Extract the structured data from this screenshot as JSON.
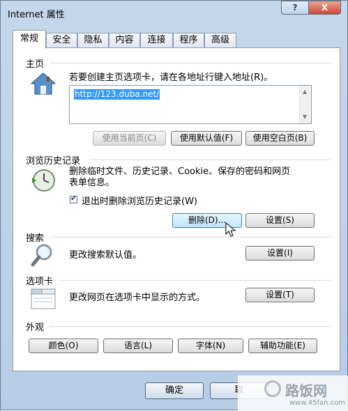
{
  "window": {
    "title": "Internet 属性",
    "help_label": "?",
    "close_label": "X"
  },
  "tabs": [
    {
      "label": "常规",
      "active": true
    },
    {
      "label": "安全"
    },
    {
      "label": "隐私"
    },
    {
      "label": "内容"
    },
    {
      "label": "连接"
    },
    {
      "label": "程序"
    },
    {
      "label": "高级"
    }
  ],
  "home": {
    "title": "主页",
    "desc": "若要创建主页选项卡，请在各地址行键入地址(R)。",
    "url": "http://123.duba.net/",
    "btn_current": "使用当前页(C)",
    "btn_default": "使用默认值(F)",
    "btn_blank": "使用空白页(B)",
    "icon": "house-icon"
  },
  "history": {
    "title": "浏览历史记录",
    "desc_line1": "删除临时文件、历史记录、Cookie、保存的密码和网页",
    "desc_line2": "表单信息。",
    "checkbox_label": "退出时删除浏览历史记录(W)",
    "checkbox_checked": true,
    "btn_delete": "删除(D)...",
    "btn_settings": "设置(S)",
    "icon": "history-clock-icon"
  },
  "search": {
    "title": "搜索",
    "desc": "更改搜索默认值。",
    "btn_settings": "设置(I)",
    "icon": "magnifier-icon"
  },
  "tabs_section": {
    "title": "选项卡",
    "desc": "更改网页在选项卡中显示的方式。",
    "btn_settings": "设置(T)",
    "icon": "tabs-window-icon"
  },
  "appearance": {
    "title": "外观",
    "btn_colors": "颜色(O)",
    "btn_languages": "语言(L)",
    "btn_fonts": "字体(N)",
    "btn_accessibility": "辅助功能(E)"
  },
  "footer": {
    "ok_label": "确定",
    "cancel_label": "取"
  },
  "watermark": {
    "text": "路饭网",
    "url": "www.45fan.com"
  },
  "colors": {
    "selection": "#3399ff",
    "window_frame": "#b7cde6",
    "close_button": "#c9473b"
  }
}
